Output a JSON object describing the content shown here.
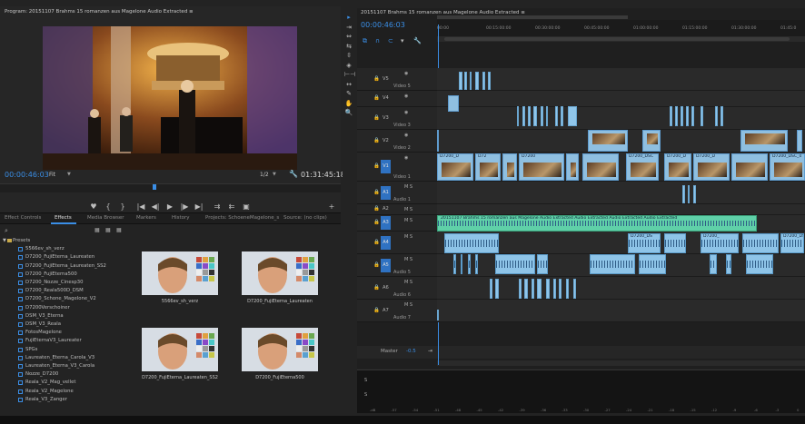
{
  "program": {
    "title": "Program: 20151107 Brahms 15 romanzen aus Magelone Audio Extracted ≡",
    "timecode": "00:00:46:03",
    "fit": "Fit",
    "page": "1/2",
    "duration": "01:31:45:18"
  },
  "transport": {
    "buttons": [
      "♥",
      "{",
      "}",
      "|◀",
      "◀|",
      "▶",
      "|▶",
      "▶|",
      "⇉",
      "⇇",
      "▣",
      "+"
    ]
  },
  "effects_panel": {
    "tabs": [
      "Effect Controls",
      "Effects",
      "Media Browser",
      "Markers",
      "History",
      "Projects: SchoeneMagelone_s",
      "Source: (no clips)"
    ],
    "active_tab": "Effects",
    "tree": [
      "Presets",
      "5566ev_sh_verz",
      "D7200_FujiEterna_Laureaten",
      "D7200_FujiEterna_Laureaten_SS2",
      "D7200_FujiEterna500",
      "D7200_Nozze_Cinesp30",
      "D7200_Reala500D_DSM",
      "D7200_Schone_Magelone_V2",
      "D7200Verschoiner",
      "DSM_V3_Eterna",
      "DSM_V3_Reala",
      "FotosMagelone",
      "FujiEternaV3_Laureater",
      "SPGs",
      "Laureaten_Eterna_Carola_V3",
      "Laureaten_Eterna_V3_Carola",
      "Nozze_D7200",
      "Reala_V2_Mag_vellet",
      "Reala_V2_Magelone",
      "Reala_V3_Zanger"
    ],
    "thumbnails": [
      "5566ev_sh_verz",
      "D7200_FujiEterna_Laureaten",
      "D7200_FujiEterna_Laureaten_SS2",
      "D7200_FujiEterna500"
    ]
  },
  "tools": [
    "▸",
    "⇥",
    "⇔",
    "⇆",
    "⇳",
    "◈",
    "⊢⊣",
    "↔",
    "✎",
    "✋",
    "🔍"
  ],
  "timeline": {
    "title": "20151107 Brahms 15 romanzen aus Magelone Audio Extracted ≡",
    "timecode": "00:00:46:03",
    "ruler": [
      "00:00",
      "00:15:00:00",
      "00:30:00:00",
      "00:45:00:00",
      "01:00:00:00",
      "01:15:00:00",
      "01:30:00:00",
      "01:45:0"
    ],
    "video_tracks": [
      {
        "id": "V5",
        "label": "Video 5"
      },
      {
        "id": "V4",
        "label": ""
      },
      {
        "id": "V3",
        "label": "Video 3"
      },
      {
        "id": "V2",
        "label": "Video 2"
      },
      {
        "id": "V1",
        "label": "Video 1"
      }
    ],
    "audio_tracks": [
      {
        "id": "A1",
        "label": "Audio 1"
      },
      {
        "id": "A2",
        "label": ""
      },
      {
        "id": "A3",
        "label": ""
      },
      {
        "id": "A4",
        "label": ""
      },
      {
        "id": "A5",
        "label": "Audio 5"
      },
      {
        "id": "A6",
        "label": "Audio 6"
      },
      {
        "id": "A7",
        "label": "Audio 7"
      }
    ],
    "clip_labels": {
      "v1": [
        "D7200_D",
        "D72",
        "D7200",
        "D7200_DSC",
        "D7200_D",
        "D7200_D",
        "D7200_DSC_0"
      ],
      "audio_long": "20151107 Brahms 15 romanzen aus Magelone Audio Extracted Audio Extracted Audio Extracted Audio Extracted",
      "a4": [
        "D7200_DS",
        "D7200_",
        "D7200_DSC_0"
      ]
    },
    "master": {
      "label": "Master",
      "value": "-0.5"
    }
  },
  "meter": {
    "labels": [
      "S",
      "S"
    ],
    "scale": [
      "-dB",
      "-57",
      "-54",
      "-51",
      "-48",
      "-45",
      "-42",
      "-39",
      "-36",
      "-33",
      "-30",
      "-27",
      "-24",
      "-21",
      "-18",
      "-15",
      "-12",
      "-9",
      "-6",
      "-3",
      "0"
    ]
  }
}
